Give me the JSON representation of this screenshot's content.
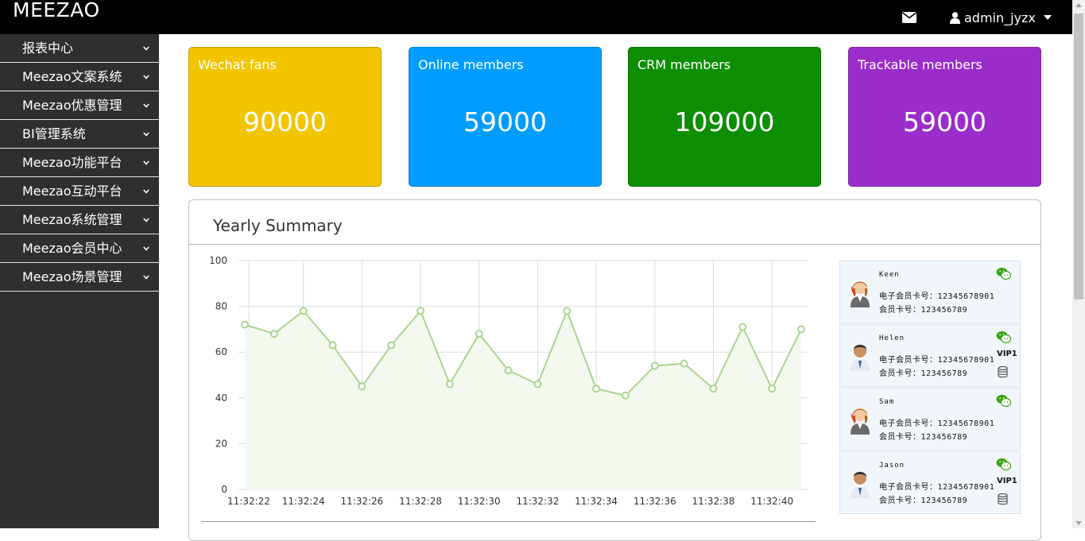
{
  "brand": "MEEZAO",
  "header": {
    "user_name": "admin_jyzx",
    "icons": [
      "envelope-icon",
      "user-icon",
      "caret-down-icon"
    ]
  },
  "sidebar": {
    "items": [
      {
        "label": "报表中心"
      },
      {
        "label": "Meezao文案系统"
      },
      {
        "label": "Meezao优惠管理"
      },
      {
        "label": "BI管理系统"
      },
      {
        "label": "Meezao功能平台"
      },
      {
        "label": "Meezao互动平台"
      },
      {
        "label": "Meezao系统管理"
      },
      {
        "label": "Meezao会员中心"
      },
      {
        "label": "Meezao场景管理"
      }
    ]
  },
  "stats": [
    {
      "title": "Wechat fans",
      "value": "90000",
      "color": "#f2c500"
    },
    {
      "title": "Online members",
      "value": "59000",
      "color": "#009cff"
    },
    {
      "title": "CRM members",
      "value": "109000",
      "color": "#0e8e03"
    },
    {
      "title": "Trackable members",
      "value": "59000",
      "color": "#9b2dcb"
    }
  ],
  "panel": {
    "title": "Yearly Summary"
  },
  "chart_data": {
    "type": "area",
    "x": [
      "11:32:22",
      "11:32:23",
      "11:32:24",
      "11:32:25",
      "11:32:26",
      "11:32:27",
      "11:32:28",
      "11:32:29",
      "11:32:30",
      "11:32:31",
      "11:32:32",
      "11:32:33",
      "11:32:34",
      "11:32:35",
      "11:32:36",
      "11:32:37",
      "11:32:38",
      "11:32:39",
      "11:32:40",
      "11:32:41"
    ],
    "x_tick_labels": [
      "11:32:22",
      "11:32:24",
      "11:32:26",
      "11:32:28",
      "11:32:30",
      "11:32:32",
      "11:32:34",
      "11:32:36",
      "11:32:38",
      "11:32:40"
    ],
    "series": [
      {
        "values": [
          72,
          68,
          78,
          63,
          45,
          63,
          78,
          46,
          68,
          52,
          46,
          78,
          44,
          41,
          54,
          55,
          44,
          71,
          44,
          70
        ]
      }
    ],
    "ylim": [
      0,
      100
    ],
    "y_ticks": [
      0,
      20,
      40,
      60,
      80,
      100
    ],
    "grid": true,
    "line_color": "#a9d58f",
    "fill_color": "#f3f9ef"
  },
  "members": [
    {
      "name": "Keen",
      "e_card_label": "电子会员卡号：",
      "e_card": "12345678901",
      "card_label": "会员卡号：",
      "card": "123456789",
      "vip": "",
      "avatar": "female-avatar-icon"
    },
    {
      "name": "Helen",
      "e_card_label": "电子会员卡号：",
      "e_card": "12345678901",
      "card_label": "会员卡号：",
      "card": "123456789",
      "vip": "VIP1",
      "avatar": "male-avatar-icon"
    },
    {
      "name": "Sam",
      "e_card_label": "电子会员卡号：",
      "e_card": "12345678901",
      "card_label": "会员卡号：",
      "card": "123456789",
      "vip": "",
      "avatar": "female-avatar-icon"
    },
    {
      "name": "Jason",
      "e_card_label": "电子会员卡号：",
      "e_card": "12345678901",
      "card_label": "会员卡号：",
      "card": "123456789",
      "vip": "VIP1",
      "avatar": "male-avatar-icon"
    }
  ]
}
